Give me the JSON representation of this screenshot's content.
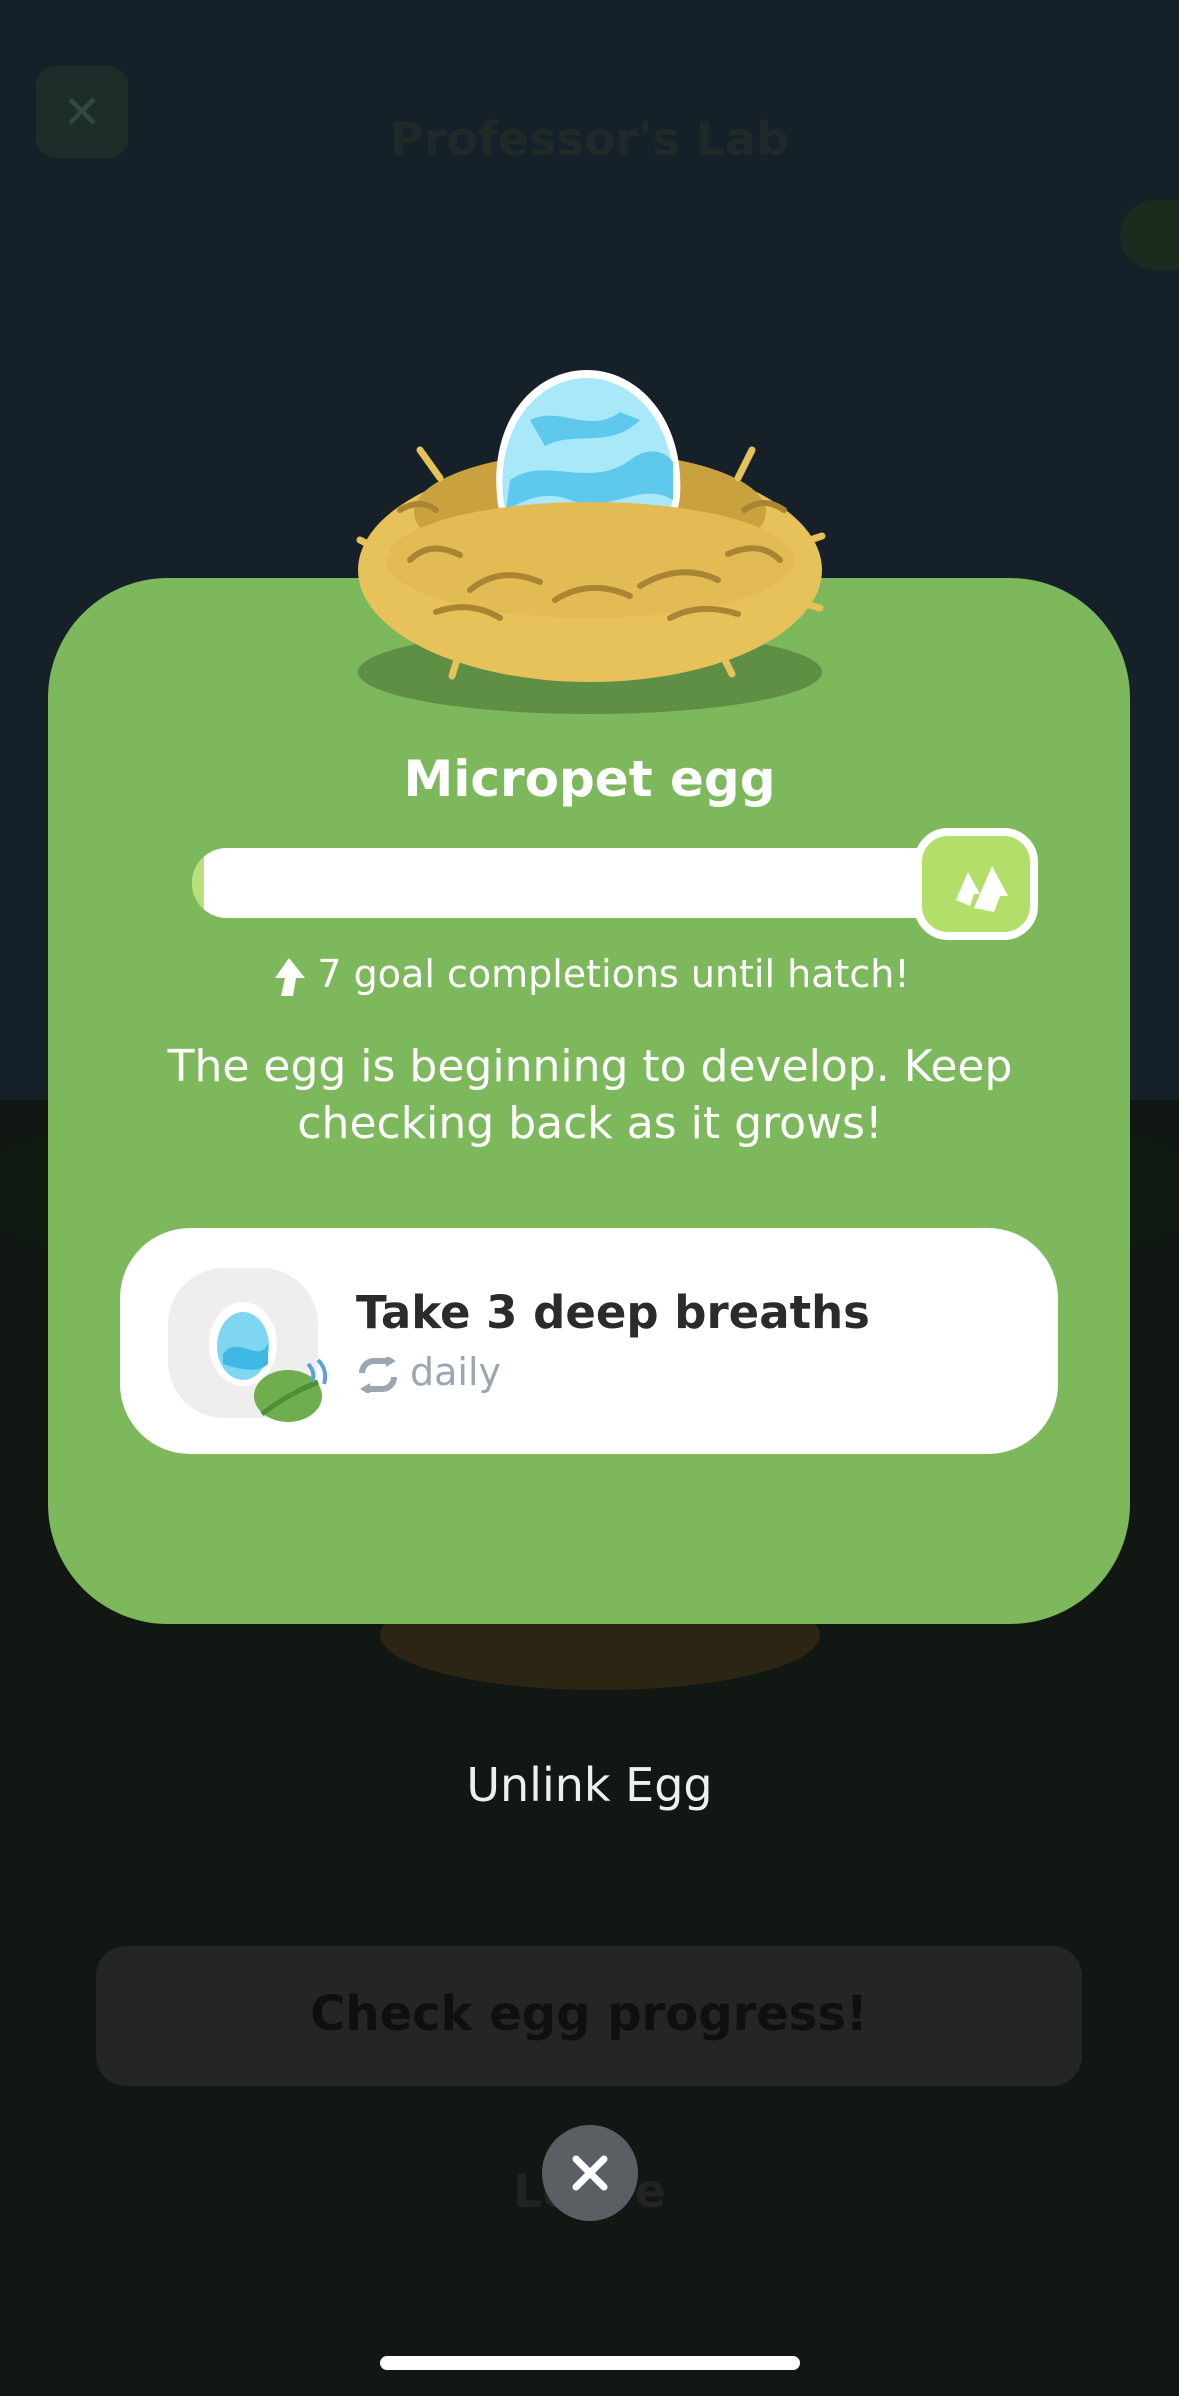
{
  "background": {
    "title": "Professor's Lab",
    "primary_button_label": "Check egg progress!",
    "leave_label": "Leave"
  },
  "modal": {
    "title": "Micropet egg",
    "progress": {
      "fraction": 0.015,
      "remaining_text": "7 goal completions until hatch!"
    },
    "description": "The egg is beginning to develop. Keep checking back as it grows!",
    "task": {
      "title": "Take 3 deep breaths",
      "frequency": "daily"
    }
  },
  "unlink_label": "Unlink Egg",
  "icons": {
    "badge": "double-arrow-up-icon",
    "close": "close-icon",
    "repeat": "repeat-icon",
    "egg": "egg-icon"
  },
  "colors": {
    "modal_bg": "#7eb85c",
    "accent": "#b3de6a",
    "egg_blue": "#7fd6f0"
  }
}
